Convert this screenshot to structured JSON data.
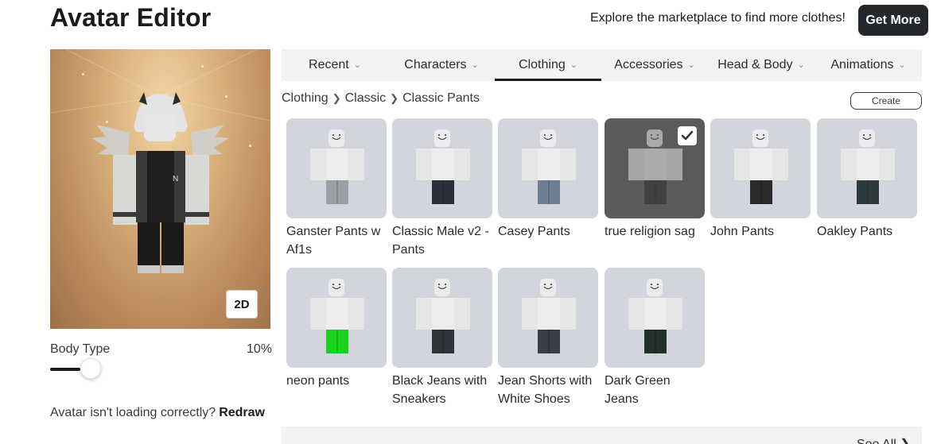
{
  "header": {
    "title": "Avatar Editor",
    "promo_text": "Explore the marketplace to find more clothes!",
    "get_more_label": "Get More"
  },
  "preview": {
    "view_toggle_label": "2D",
    "body_type_label": "Body Type",
    "body_type_value": "10%",
    "body_type_fraction": 0.1,
    "loading_note": "Avatar isn't loading correctly?",
    "redraw_label": "Redraw"
  },
  "tabs": [
    {
      "label": "Recent",
      "active": false
    },
    {
      "label": "Characters",
      "active": false
    },
    {
      "label": "Clothing",
      "active": true
    },
    {
      "label": "Accessories",
      "active": false
    },
    {
      "label": "Head & Body",
      "active": false
    },
    {
      "label": "Animations",
      "active": false
    }
  ],
  "breadcrumb": [
    "Clothing",
    "Classic",
    "Classic Pants"
  ],
  "create_label": "Create",
  "items": [
    {
      "name": "Ganster Pants w Af1s",
      "pants": "#9aa0a4",
      "selected": false
    },
    {
      "name": "Classic Male v2 - Pants",
      "pants": "#2a2f3a",
      "selected": false
    },
    {
      "name": "Casey Pants",
      "pants": "#6e7f93",
      "selected": false
    },
    {
      "name": "true religion sag",
      "pants": "#2e2e2e",
      "selected": true
    },
    {
      "name": "John Pants",
      "pants": "#2a2a2a",
      "selected": false
    },
    {
      "name": "Oakley Pants",
      "pants": "#2d3b3d",
      "selected": false
    },
    {
      "name": "neon pants",
      "pants": "#18d21c",
      "selected": false
    },
    {
      "name": "Black Jeans with Sneakers",
      "pants": "#303338",
      "selected": false
    },
    {
      "name": "Jean Shorts with White Shoes",
      "pants": "#3a3d44",
      "selected": false
    },
    {
      "name": "Dark Green Jeans",
      "pants": "#22302a",
      "selected": false
    }
  ],
  "see_all_label": "See All",
  "colors": {
    "accent_dark": "#24272b",
    "tab_bg": "#f2f3f4",
    "thumb_bg": "#d3d5dc",
    "neon_green": "#18d21c"
  }
}
